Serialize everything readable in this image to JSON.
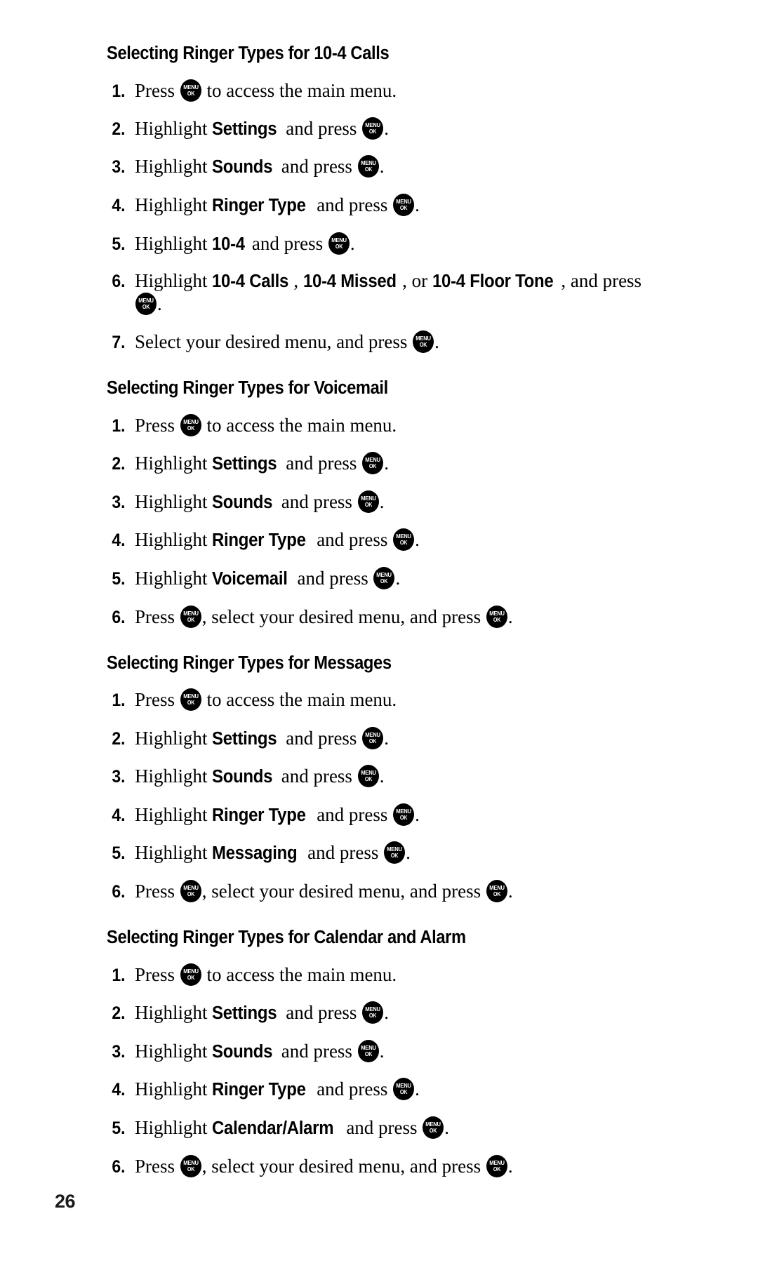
{
  "document": {
    "page_number": "26",
    "key_icon": {
      "name": "menu-ok-key-icon",
      "line1": "MENU",
      "line2": "OK",
      "color": "#000000",
      "text_color": "#ffffff"
    },
    "sections": [
      {
        "heading": "Selecting Ringer Types for 10-4 Calls",
        "steps": [
          {
            "number": "1.",
            "parts": [
              {
                "type": "text",
                "value": "Press "
              },
              {
                "type": "key"
              },
              {
                "type": "text",
                "value": " to access the main menu."
              }
            ]
          },
          {
            "number": "2.",
            "parts": [
              {
                "type": "text",
                "value": "Highlight "
              },
              {
                "type": "bold",
                "value": "Settings"
              },
              {
                "type": "text",
                "value": " and press "
              },
              {
                "type": "key"
              },
              {
                "type": "text",
                "value": "."
              }
            ]
          },
          {
            "number": "3.",
            "parts": [
              {
                "type": "text",
                "value": "Highlight "
              },
              {
                "type": "bold",
                "value": "Sounds"
              },
              {
                "type": "text",
                "value": " and press "
              },
              {
                "type": "key"
              },
              {
                "type": "text",
                "value": "."
              }
            ]
          },
          {
            "number": "4.",
            "parts": [
              {
                "type": "text",
                "value": "Highlight "
              },
              {
                "type": "bold",
                "value": "Ringer Type"
              },
              {
                "type": "text",
                "value": " and press "
              },
              {
                "type": "key"
              },
              {
                "type": "text",
                "value": "."
              }
            ]
          },
          {
            "number": "5.",
            "parts": [
              {
                "type": "text",
                "value": "Highlight "
              },
              {
                "type": "bold",
                "value": "10-4"
              },
              {
                "type": "text",
                "value": " and press "
              },
              {
                "type": "key"
              },
              {
                "type": "text",
                "value": "."
              }
            ]
          },
          {
            "number": "6.",
            "parts": [
              {
                "type": "text",
                "value": "Highlight "
              },
              {
                "type": "bold",
                "value": "10-4 Calls"
              },
              {
                "type": "text",
                "value": ", "
              },
              {
                "type": "bold",
                "value": "10-4 Missed"
              },
              {
                "type": "text",
                "value": ", or "
              },
              {
                "type": "bold",
                "value": "10-4 Floor Tone"
              },
              {
                "type": "text",
                "value": ", and press "
              },
              {
                "type": "key"
              },
              {
                "type": "text",
                "value": "."
              }
            ]
          },
          {
            "number": "7.",
            "parts": [
              {
                "type": "text",
                "value": "Select your desired menu, and press "
              },
              {
                "type": "key"
              },
              {
                "type": "text",
                "value": "."
              }
            ]
          }
        ]
      },
      {
        "heading": "Selecting Ringer Types for Voicemail",
        "steps": [
          {
            "number": "1.",
            "parts": [
              {
                "type": "text",
                "value": "Press "
              },
              {
                "type": "key"
              },
              {
                "type": "text",
                "value": " to access the main menu."
              }
            ]
          },
          {
            "number": "2.",
            "parts": [
              {
                "type": "text",
                "value": "Highlight "
              },
              {
                "type": "bold",
                "value": "Settings"
              },
              {
                "type": "text",
                "value": " and press "
              },
              {
                "type": "key"
              },
              {
                "type": "text",
                "value": "."
              }
            ]
          },
          {
            "number": "3.",
            "parts": [
              {
                "type": "text",
                "value": "Highlight "
              },
              {
                "type": "bold",
                "value": "Sounds"
              },
              {
                "type": "text",
                "value": " and press "
              },
              {
                "type": "key"
              },
              {
                "type": "text",
                "value": "."
              }
            ]
          },
          {
            "number": "4.",
            "parts": [
              {
                "type": "text",
                "value": "Highlight "
              },
              {
                "type": "bold",
                "value": "Ringer Type"
              },
              {
                "type": "text",
                "value": " and press "
              },
              {
                "type": "key"
              },
              {
                "type": "text",
                "value": "."
              }
            ]
          },
          {
            "number": "5.",
            "parts": [
              {
                "type": "text",
                "value": "Highlight "
              },
              {
                "type": "bold",
                "value": "Voicemail"
              },
              {
                "type": "text",
                "value": " and press "
              },
              {
                "type": "key"
              },
              {
                "type": "text",
                "value": "."
              }
            ]
          },
          {
            "number": "6.",
            "parts": [
              {
                "type": "text",
                "value": "Press "
              },
              {
                "type": "key"
              },
              {
                "type": "text",
                "value": ", select your desired menu, and press "
              },
              {
                "type": "key"
              },
              {
                "type": "text",
                "value": "."
              }
            ]
          }
        ]
      },
      {
        "heading": "Selecting Ringer Types for Messages",
        "steps": [
          {
            "number": "1.",
            "parts": [
              {
                "type": "text",
                "value": "Press "
              },
              {
                "type": "key"
              },
              {
                "type": "text",
                "value": " to access the main menu."
              }
            ]
          },
          {
            "number": "2.",
            "parts": [
              {
                "type": "text",
                "value": "Highlight "
              },
              {
                "type": "bold",
                "value": "Settings"
              },
              {
                "type": "text",
                "value": " and press "
              },
              {
                "type": "key"
              },
              {
                "type": "text",
                "value": "."
              }
            ]
          },
          {
            "number": "3.",
            "parts": [
              {
                "type": "text",
                "value": "Highlight "
              },
              {
                "type": "bold",
                "value": "Sounds"
              },
              {
                "type": "text",
                "value": " and press "
              },
              {
                "type": "key"
              },
              {
                "type": "text",
                "value": "."
              }
            ]
          },
          {
            "number": "4.",
            "parts": [
              {
                "type": "text",
                "value": "Highlight "
              },
              {
                "type": "bold",
                "value": "Ringer Type"
              },
              {
                "type": "text",
                "value": " and press "
              },
              {
                "type": "key"
              },
              {
                "type": "text",
                "value": "."
              }
            ]
          },
          {
            "number": "5.",
            "parts": [
              {
                "type": "text",
                "value": "Highlight "
              },
              {
                "type": "bold",
                "value": "Messaging"
              },
              {
                "type": "text",
                "value": " and press "
              },
              {
                "type": "key"
              },
              {
                "type": "text",
                "value": "."
              }
            ]
          },
          {
            "number": "6.",
            "parts": [
              {
                "type": "text",
                "value": "Press "
              },
              {
                "type": "key"
              },
              {
                "type": "text",
                "value": ", select your desired menu, and press "
              },
              {
                "type": "key"
              },
              {
                "type": "text",
                "value": "."
              }
            ]
          }
        ]
      },
      {
        "heading": "Selecting Ringer Types for Calendar and Alarm",
        "steps": [
          {
            "number": "1.",
            "parts": [
              {
                "type": "text",
                "value": "Press "
              },
              {
                "type": "key"
              },
              {
                "type": "text",
                "value": " to access the main menu."
              }
            ]
          },
          {
            "number": "2.",
            "parts": [
              {
                "type": "text",
                "value": "Highlight "
              },
              {
                "type": "bold",
                "value": "Settings"
              },
              {
                "type": "text",
                "value": " and press "
              },
              {
                "type": "key"
              },
              {
                "type": "text",
                "value": "."
              }
            ]
          },
          {
            "number": "3.",
            "parts": [
              {
                "type": "text",
                "value": "Highlight "
              },
              {
                "type": "bold",
                "value": "Sounds"
              },
              {
                "type": "text",
                "value": " and press "
              },
              {
                "type": "key"
              },
              {
                "type": "text",
                "value": "."
              }
            ]
          },
          {
            "number": "4.",
            "parts": [
              {
                "type": "text",
                "value": "Highlight "
              },
              {
                "type": "bold",
                "value": "Ringer Type"
              },
              {
                "type": "text",
                "value": " and press "
              },
              {
                "type": "key"
              },
              {
                "type": "text",
                "value": "."
              }
            ]
          },
          {
            "number": "5.",
            "parts": [
              {
                "type": "text",
                "value": "Highlight "
              },
              {
                "type": "bold",
                "value": "Calendar/Alarm"
              },
              {
                "type": "text",
                "value": " and press "
              },
              {
                "type": "key"
              },
              {
                "type": "text",
                "value": "."
              }
            ]
          },
          {
            "number": "6.",
            "parts": [
              {
                "type": "text",
                "value": "Press "
              },
              {
                "type": "key"
              },
              {
                "type": "text",
                "value": ", select your desired menu, and press "
              },
              {
                "type": "key"
              },
              {
                "type": "text",
                "value": "."
              }
            ]
          }
        ]
      }
    ]
  }
}
